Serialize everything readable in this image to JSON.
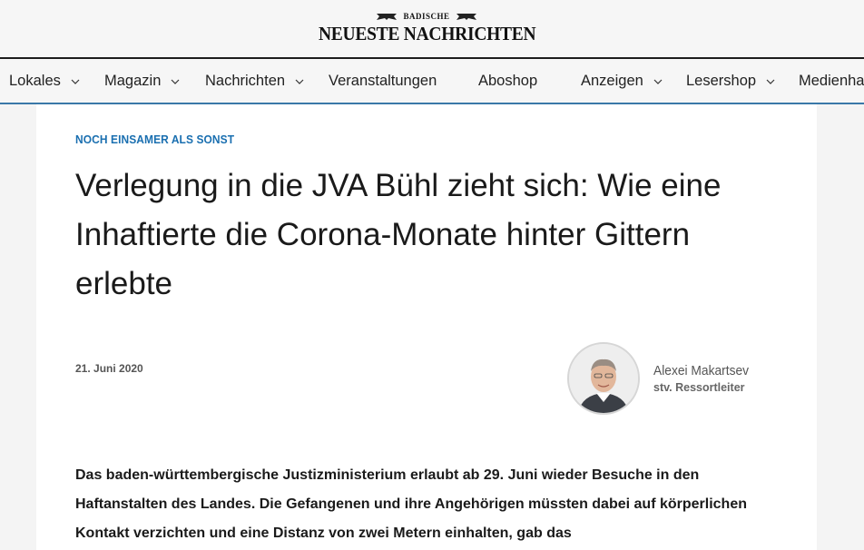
{
  "brand": {
    "top_line": "BADISCHE",
    "name": "NEUESTE NACHRICHTEN"
  },
  "nav": {
    "items": [
      {
        "label": "Lokales",
        "has_dropdown": true
      },
      {
        "label": "Magazin",
        "has_dropdown": true
      },
      {
        "label": "Nachrichten",
        "has_dropdown": true
      },
      {
        "label": "Veranstaltungen",
        "has_dropdown": false
      },
      {
        "label": "Aboshop",
        "has_dropdown": false
      },
      {
        "label": "Anzeigen",
        "has_dropdown": true
      },
      {
        "label": "Lesershop",
        "has_dropdown": true
      },
      {
        "label": "Medienhaus",
        "has_dropdown": false
      }
    ]
  },
  "article": {
    "kicker": "NOCH EINSAMER ALS SONST",
    "headline": "Verlegung in die JVA Bühl zieht sich: Wie eine Inhaftierte die Corona-Monate hinter Gittern erlebte",
    "date": "21. Juni 2020",
    "author": {
      "name": "Alexei Makartsev",
      "role": "stv. Ressortleiter"
    },
    "lead": "Das baden-württembergische Justizministerium erlaubt ab 29. Juni wieder Besuche in den Haftanstalten des Landes. Die Gefangenen und ihre Angehörigen müssten dabei auf körperlichen Kontakt verzichten und eine Distanz von zwei Metern einhalten, gab das"
  },
  "colors": {
    "kicker": "#1a6fb0",
    "nav_underline": "#3a78a8"
  },
  "icons": {
    "dropdown": "chevron-down-icon",
    "brand_crest": "crest-icon"
  }
}
